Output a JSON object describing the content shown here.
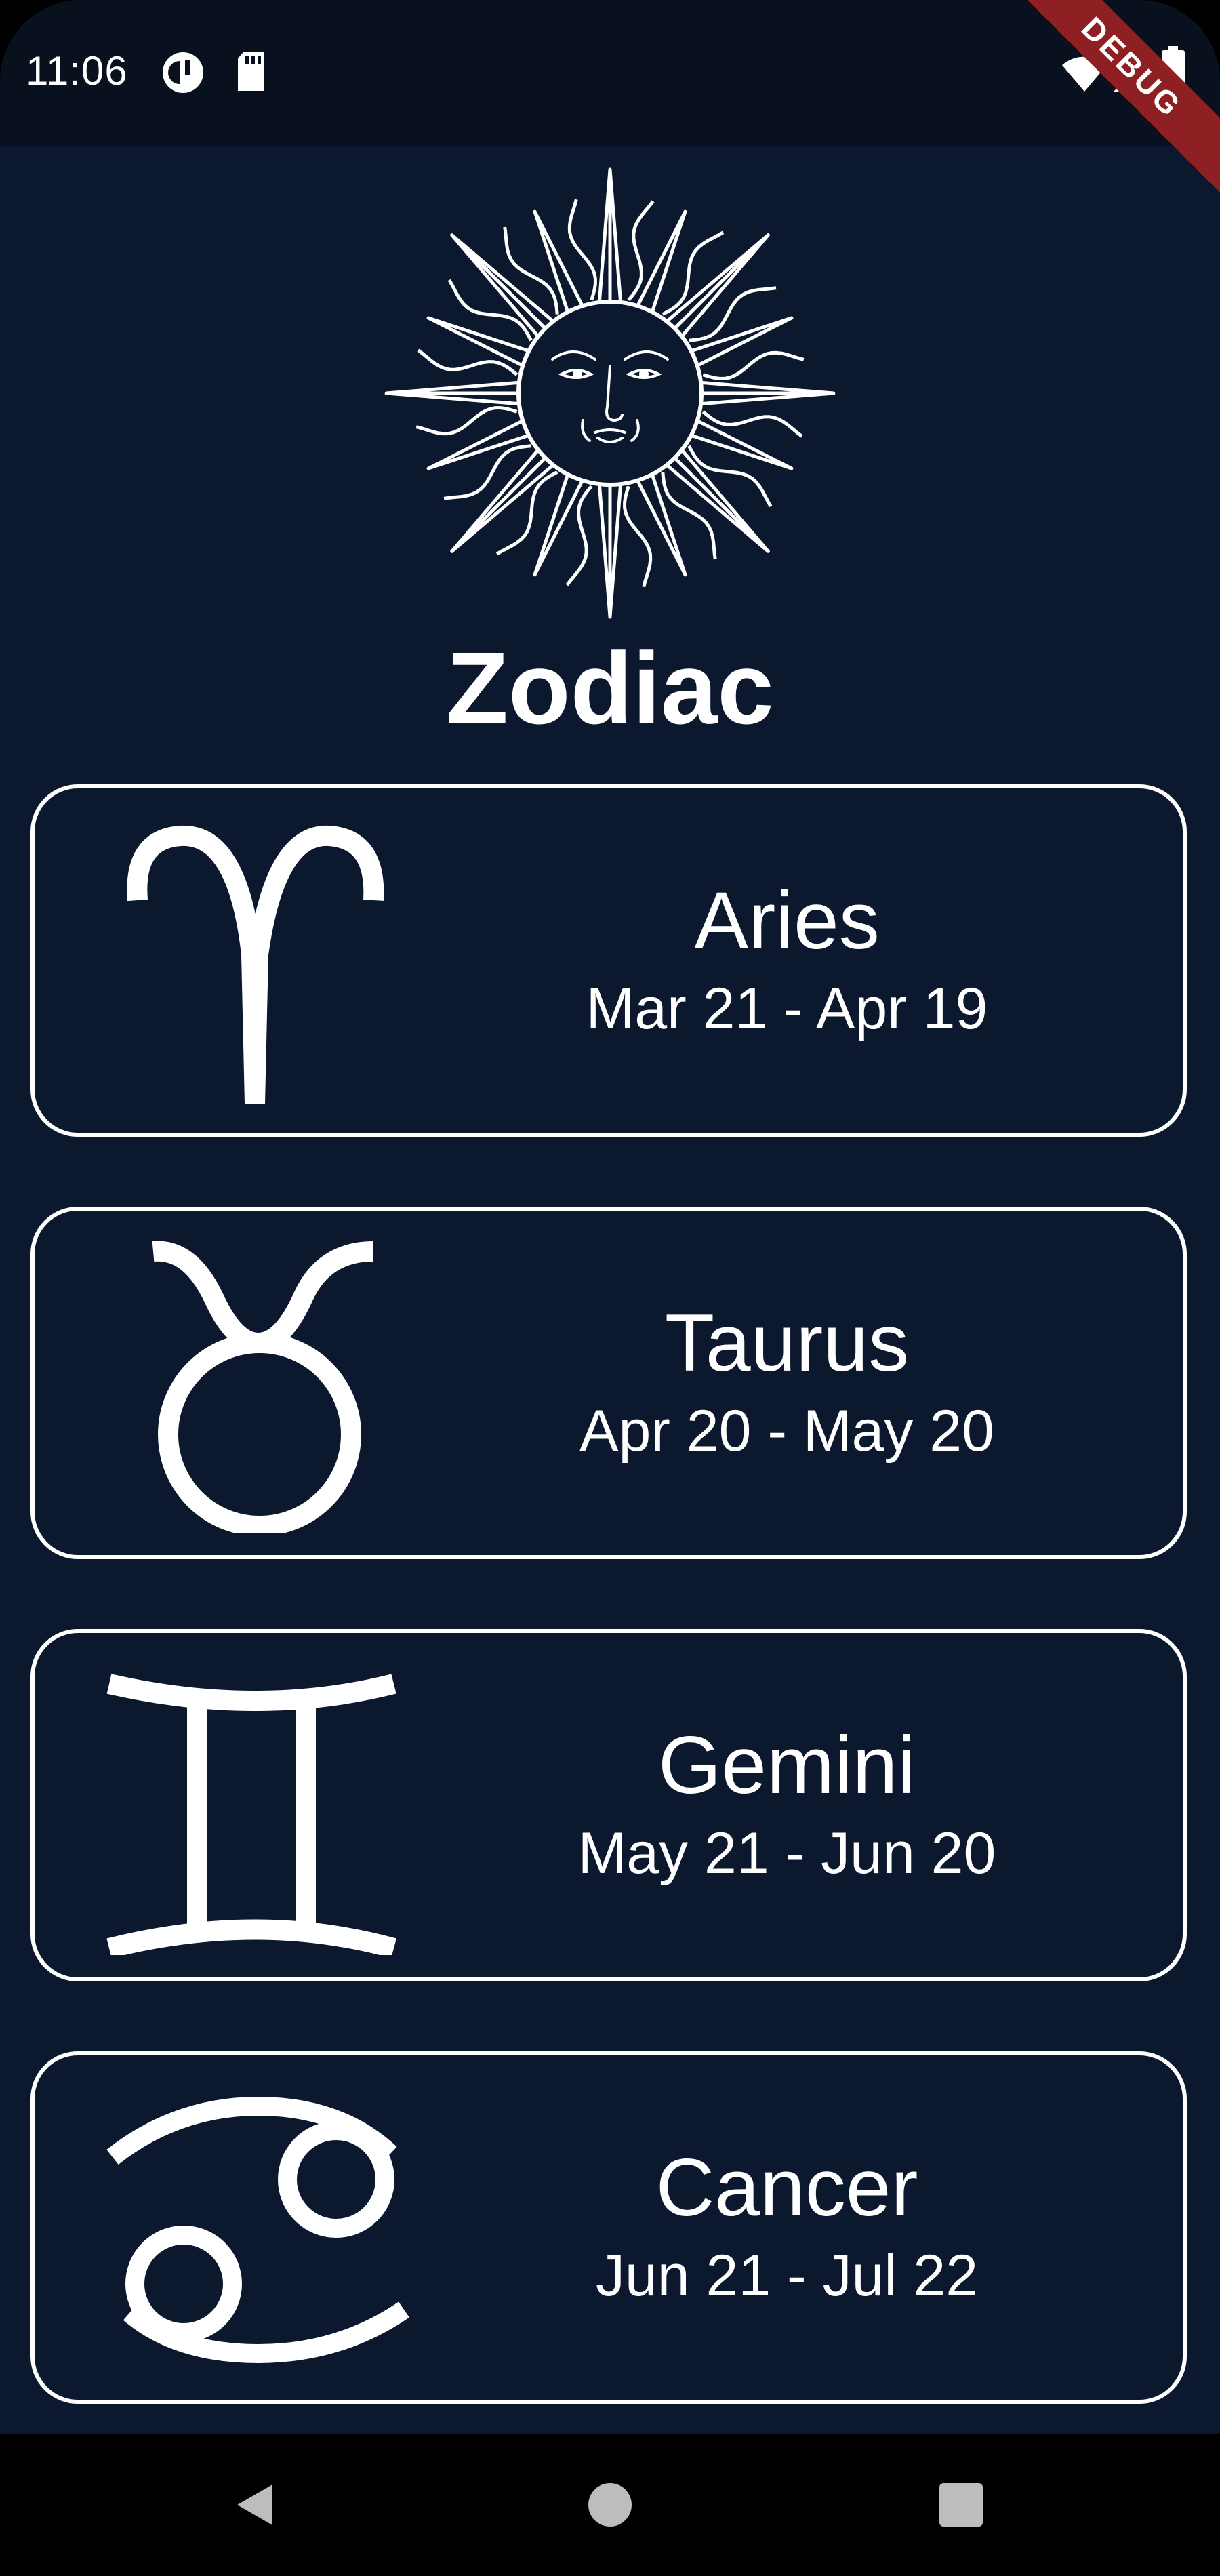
{
  "status_bar": {
    "time": "11:06",
    "icons": [
      "notification-icon",
      "sd-card-icon",
      "wifi-icon",
      "signal-icon",
      "battery-icon"
    ],
    "debug_banner": "DEBUG"
  },
  "header": {
    "logo": "sun-face-icon",
    "title": "Zodiac"
  },
  "signs": [
    {
      "name": "Aries",
      "dates": "Mar 21 - Apr 19",
      "icon": "aries-icon"
    },
    {
      "name": "Taurus",
      "dates": "Apr 20 - May 20",
      "icon": "taurus-icon"
    },
    {
      "name": "Gemini",
      "dates": "May 21 - Jun 20",
      "icon": "gemini-icon"
    },
    {
      "name": "Cancer",
      "dates": "Jun 21 - Jul 22",
      "icon": "cancer-icon"
    }
  ],
  "nav_bar": {
    "buttons": [
      "back-icon",
      "home-icon",
      "recents-icon"
    ]
  },
  "colors": {
    "background": "#0c182d",
    "status_bar": "#09111e",
    "foreground": "#ffffff",
    "debug_banner": "#8e1f22"
  }
}
